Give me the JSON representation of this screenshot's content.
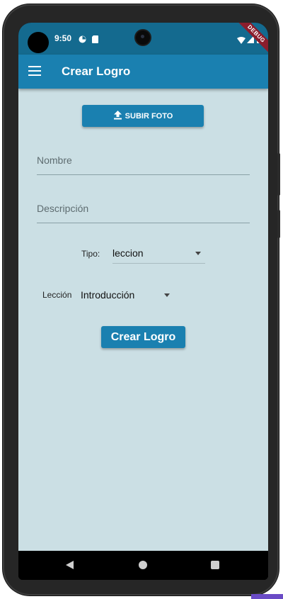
{
  "status_bar": {
    "time": "9:50",
    "debug_label": "DEBUG"
  },
  "app_bar": {
    "title": "Crear Logro",
    "menu_icon": "hamburger-menu-icon"
  },
  "form": {
    "upload_label": "SUBIR FOTO",
    "upload_icon": "upload-icon",
    "name_placeholder": "Nombre",
    "name_value": "",
    "description_placeholder": "Descripción",
    "description_value": "",
    "type_label": "Tipo:",
    "type_value": "leccion",
    "lesson_label": "Lección",
    "lesson_value": "Introducción",
    "submit_label": "Crear Logro"
  },
  "colors": {
    "status_bar": "#146a8f",
    "app_bar": "#1a80b0",
    "background": "#cbdfe4",
    "button": "#1a80b0"
  }
}
